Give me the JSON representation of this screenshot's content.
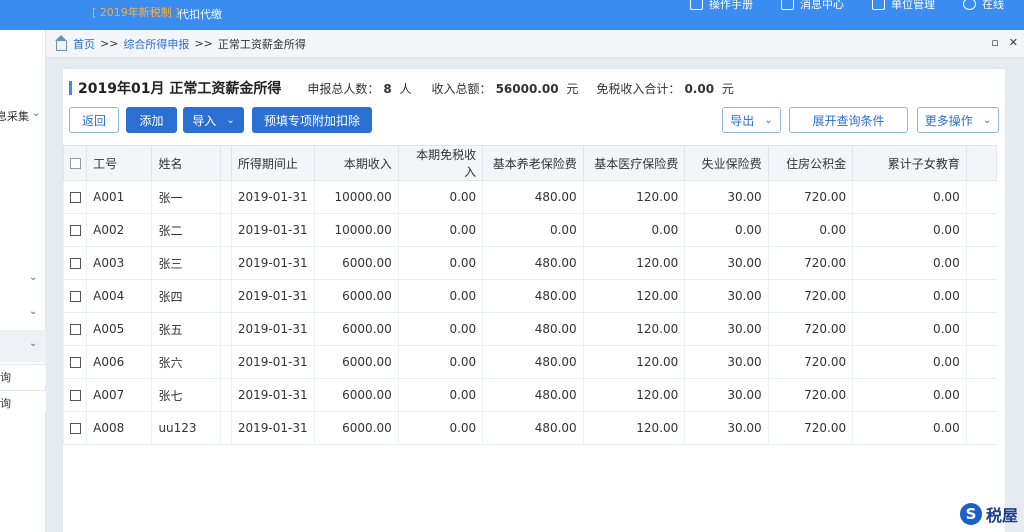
{
  "topbar": {
    "tag": "[ 2019年新税制 ]",
    "mode": "代扣代缴",
    "nav": [
      {
        "label": "操作手册",
        "icon": "manual-icon"
      },
      {
        "label": "消息中心",
        "icon": "message-icon"
      },
      {
        "label": "单位管理",
        "icon": "unit-icon"
      },
      {
        "label": "在线",
        "icon": "online-icon"
      }
    ]
  },
  "sidebar": {
    "collect_label": "息采集",
    "query1": "询",
    "query2": "询"
  },
  "breadcrumb": {
    "home": "首页",
    "sep": ">>",
    "level1": "综合所得申报",
    "current": "正常工资薪金所得"
  },
  "panel": {
    "title": "2019年01月 正常工资薪金所得",
    "stats": {
      "people_label": "申报总人数：",
      "people_value": "8",
      "people_unit": "人",
      "income_label": "收入总额：",
      "income_value": "56000.00",
      "income_unit": "元",
      "exempt_label": "免税收入合计：",
      "exempt_value": "0.00",
      "exempt_unit": "元"
    }
  },
  "toolbar": {
    "back": "返回",
    "add": "添加",
    "import": "导入",
    "prefill": "预填专项附加扣除",
    "export": "导出",
    "expand_query": "展开查询条件",
    "more": "更多操作"
  },
  "table": {
    "headers": [
      "工号",
      "姓名",
      "所得期间止",
      "本期收入",
      "本期免税收入",
      "基本养老保险费",
      "基本医疗保险费",
      "失业保险费",
      "住房公积金",
      "累计子女教育"
    ],
    "rows": [
      {
        "id": "A001",
        "name": "张一",
        "period": "2019-01-31",
        "income": "10000.00",
        "exempt": "0.00",
        "pension": "480.00",
        "medical": "120.00",
        "unemploy": "30.00",
        "housing": "720.00",
        "child": "0.00"
      },
      {
        "id": "A002",
        "name": "张二",
        "period": "2019-01-31",
        "income": "10000.00",
        "exempt": "0.00",
        "pension": "0.00",
        "medical": "0.00",
        "unemploy": "0.00",
        "housing": "0.00",
        "child": "0.00"
      },
      {
        "id": "A003",
        "name": "张三",
        "period": "2019-01-31",
        "income": "6000.00",
        "exempt": "0.00",
        "pension": "480.00",
        "medical": "120.00",
        "unemploy": "30.00",
        "housing": "720.00",
        "child": "0.00"
      },
      {
        "id": "A004",
        "name": "张四",
        "period": "2019-01-31",
        "income": "6000.00",
        "exempt": "0.00",
        "pension": "480.00",
        "medical": "120.00",
        "unemploy": "30.00",
        "housing": "720.00",
        "child": "0.00"
      },
      {
        "id": "A005",
        "name": "张五",
        "period": "2019-01-31",
        "income": "6000.00",
        "exempt": "0.00",
        "pension": "480.00",
        "medical": "120.00",
        "unemploy": "30.00",
        "housing": "720.00",
        "child": "0.00"
      },
      {
        "id": "A006",
        "name": "张六",
        "period": "2019-01-31",
        "income": "6000.00",
        "exempt": "0.00",
        "pension": "480.00",
        "medical": "120.00",
        "unemploy": "30.00",
        "housing": "720.00",
        "child": "0.00"
      },
      {
        "id": "A007",
        "name": "张七",
        "period": "2019-01-31",
        "income": "6000.00",
        "exempt": "0.00",
        "pension": "480.00",
        "medical": "120.00",
        "unemploy": "30.00",
        "housing": "720.00",
        "child": "0.00"
      },
      {
        "id": "A008",
        "name": "uu123",
        "period": "2019-01-31",
        "income": "6000.00",
        "exempt": "0.00",
        "pension": "480.00",
        "medical": "120.00",
        "unemploy": "30.00",
        "housing": "720.00",
        "child": "0.00"
      }
    ]
  },
  "logo": {
    "mark": "S",
    "text": "税屋"
  },
  "colors": {
    "topbar": "#3b8cf0",
    "primary_button": "#2b6fd3",
    "link": "#2a6fd6"
  }
}
